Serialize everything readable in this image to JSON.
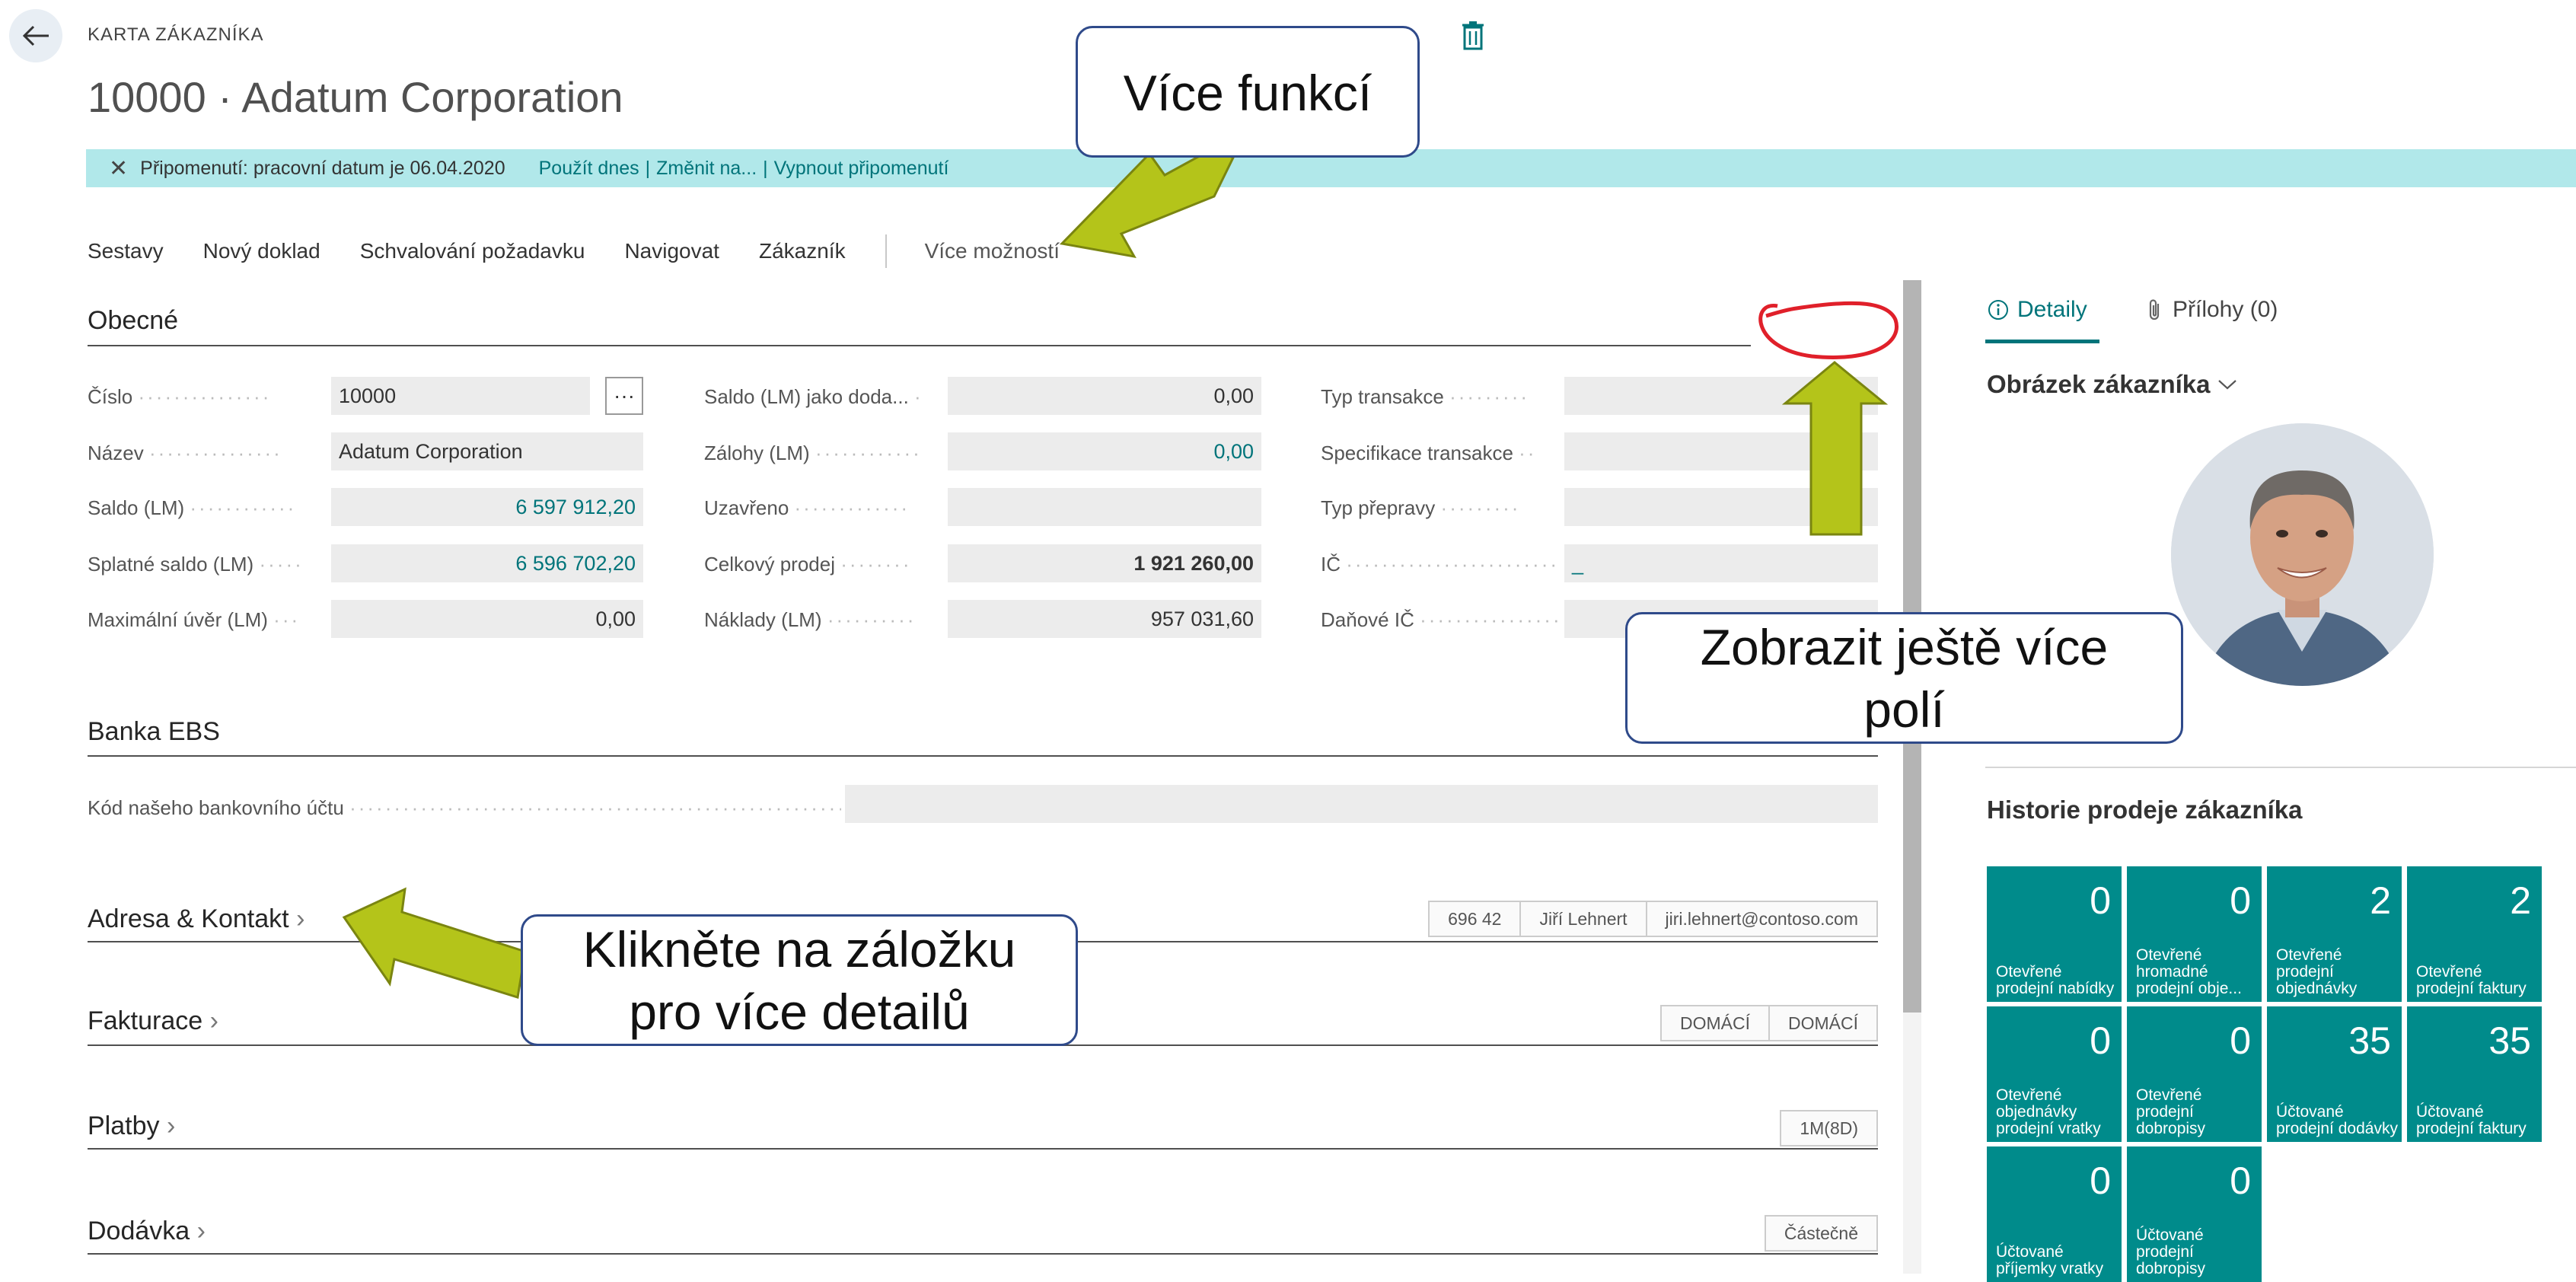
{
  "header": {
    "caption": "KARTA ZÁKAZNÍKA",
    "title": "10000 · Adatum Corporation"
  },
  "notification": {
    "text": "Připomenutí: pracovní datum je 06.04.2020",
    "use_today": "Použít dnes",
    "change": "Změnit na...",
    "turn_off": "Vypnout připomenutí",
    "separator": "|"
  },
  "actions": {
    "reports": "Sestavy",
    "new_document": "Nový doklad",
    "approval": "Schvalování požadavku",
    "navigate": "Navigovat",
    "customer": "Zákazník",
    "more": "Více možností"
  },
  "general": {
    "title": "Obecné",
    "col1": [
      {
        "label": "Číslo",
        "value": "10000"
      },
      {
        "label": "Název",
        "value": "Adatum Corporation"
      },
      {
        "label": "Saldo (LM)",
        "value": "6 597 912,20"
      },
      {
        "label": "Splatné saldo (LM)",
        "value": "6 596 702,20"
      },
      {
        "label": "Maximální úvěr (LM)",
        "value": "0,00"
      }
    ],
    "ellipsis": "···",
    "col2": [
      {
        "label": "Saldo (LM) jako doda...",
        "value": "0,00"
      },
      {
        "label": "Zálohy (LM)",
        "value": "0,00"
      },
      {
        "label": "Uzavřeno",
        "value": ""
      },
      {
        "label": "Celkový prodej",
        "value": "1 921 260,00"
      },
      {
        "label": "Náklady (LM)",
        "value": "957 031,60"
      }
    ],
    "col3": [
      {
        "label": "Typ transakce",
        "value": ""
      },
      {
        "label": "Specifikace transakce",
        "value": ""
      },
      {
        "label": "Typ přepravy",
        "value": ""
      },
      {
        "label": "IČ",
        "value": "_"
      },
      {
        "label": "Daňové IČ",
        "value": ""
      }
    ]
  },
  "bank": {
    "title": "Banka EBS",
    "label": "Kód našeho bankovního účtu",
    "value": ""
  },
  "sections": {
    "address": {
      "title": "Adresa & Kontakt",
      "chips": [
        "696 42",
        "Jiří Lehnert",
        "jiri.lehnert@contoso.com"
      ]
    },
    "invoicing": {
      "title": "Fakturace",
      "chips": [
        "DOMÁCÍ",
        "DOMÁCÍ"
      ]
    },
    "payments": {
      "title": "Platby",
      "chips": [
        "1M(8D)"
      ]
    },
    "shipping": {
      "title": "Dodávka",
      "chips": [
        "Částečně"
      ]
    }
  },
  "factbox": {
    "tab_details": "Detaily",
    "tab_attachments": "Přílohy (0)",
    "picture_heading": "Obrázek zákazníka",
    "history_heading": "Historie prodeje zákazníka",
    "tiles": [
      {
        "num": "0",
        "label": "Otevřené prodejní nabídky"
      },
      {
        "num": "0",
        "label": "Otevřené hromadné prodejní obje..."
      },
      {
        "num": "2",
        "label": "Otevřené prodejní objednávky"
      },
      {
        "num": "2",
        "label": "Otevřené prodejní faktury"
      },
      {
        "num": "0",
        "label": "Otevřené objednávky prodejní vratky"
      },
      {
        "num": "0",
        "label": "Otevřené prodejní dobropisy"
      },
      {
        "num": "35",
        "label": "Účtované prodejní dodávky"
      },
      {
        "num": "35",
        "label": "Účtované prodejní faktury"
      },
      {
        "num": "0",
        "label": "Účtované příjemky vratky"
      },
      {
        "num": "0",
        "label": "Účtované prodejní dobropisy"
      }
    ]
  },
  "callouts": {
    "more_functions": "Více funkcí",
    "more_fields": "Zobrazit ještě více polí",
    "click_tab": "Klikněte na záložku pro více detailů"
  },
  "colors": {
    "accent": "#00747a",
    "tile": "#008b8b",
    "notification": "#b1e8ea",
    "arrow": "#b4c41a",
    "annotation_red": "#e0202a"
  }
}
